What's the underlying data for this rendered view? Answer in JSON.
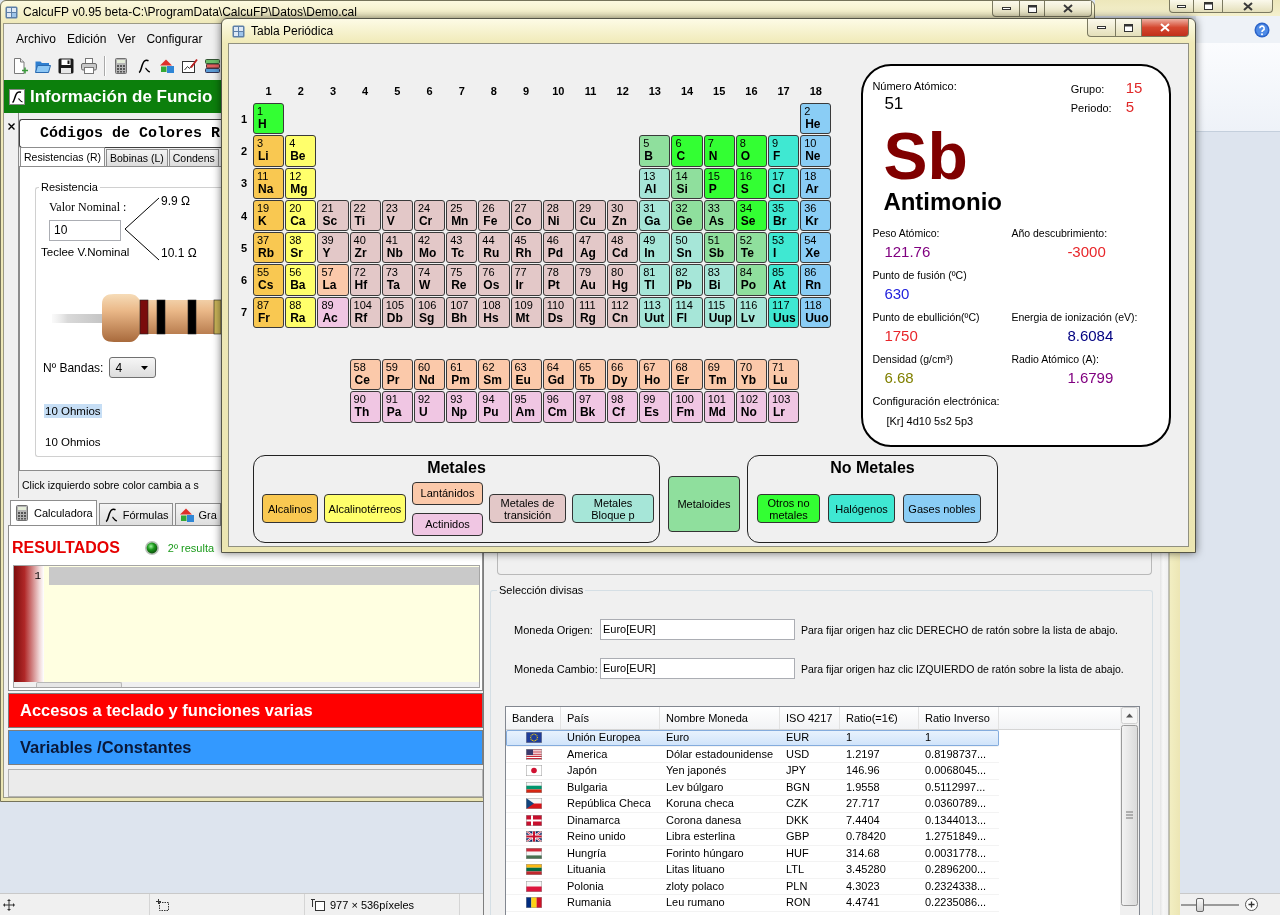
{
  "viewer": {
    "active": false,
    "status_bar": {
      "image_size": "977 × 536píxeles"
    },
    "zoom_slider": {
      "level": 0.3
    }
  },
  "main_window": {
    "active": false,
    "title": "CalcuFP v0.95 beta-C:\\ProgramData\\CalcuFP\\Datos\\Demo.cal",
    "menu": [
      "Archivo",
      "Edición",
      "Ver",
      "Configurar"
    ],
    "banner": "Información de Funcio",
    "color_codes": {
      "title": "Códigos de Colores R",
      "tabs": [
        {
          "label": "Resistencias (R)",
          "selected": true
        },
        {
          "label": "Bobinas (L)",
          "selected": false
        },
        {
          "label": "Condens",
          "selected": false
        }
      ],
      "group": "Resistencia",
      "nominal_label": "Valor Nominal :",
      "nominal_value": "10",
      "hint": "Teclee V.Nominal",
      "min_value": "9.9 Ω",
      "max_value": "10.1 Ω",
      "bands": [
        {
          "color": "#7a0c0c"
        },
        {
          "color": "#000000"
        },
        {
          "color": "#000000"
        },
        {
          "color": "#c9b458"
        }
      ],
      "bands_label": "Nº Bandas:",
      "bands_count": "4",
      "readings": [
        {
          "text": "10 Ohmios",
          "selected": true
        },
        {
          "text": "10 Ohmios",
          "selected": false
        }
      ],
      "status": "Click izquierdo sobre color cambia a s"
    },
    "calc_tabs": [
      {
        "label": "Calculadora",
        "selected": true
      },
      {
        "label": "Fórmulas",
        "selected": false
      },
      {
        "label": "Gra",
        "selected": false
      }
    ],
    "results": {
      "title": "RESULTADOS",
      "note": "2º resulta",
      "line_numbers": [
        "1"
      ]
    },
    "panels": [
      {
        "label": "Accesos a teclado y funciones varias",
        "color": "#ff0000"
      },
      {
        "label": "Variables /Constantes",
        "color": "#3399ff"
      }
    ]
  },
  "periodic_window": {
    "active": true,
    "title": "Tabla Periódica",
    "groups": [
      "1",
      "2",
      "3",
      "4",
      "5",
      "6",
      "7",
      "8",
      "9",
      "10",
      "11",
      "12",
      "13",
      "14",
      "15",
      "16",
      "17",
      "18"
    ],
    "periods": [
      {
        "label": "1",
        "s_block": [
          {
            "number": "1",
            "symbol": "H",
            "kind": "nonmetal"
          }
        ],
        "p_block": [
          {
            "number": "2",
            "symbol": "He",
            "kind": "noble_gas"
          }
        ]
      },
      {
        "label": "2",
        "s_block": [
          {
            "number": "3",
            "symbol": "Li",
            "kind": "alkali"
          },
          {
            "number": "4",
            "symbol": "Be",
            "kind": "alkaline_earth"
          }
        ],
        "p_block": [
          {
            "number": "5",
            "symbol": "B",
            "kind": "metalloid"
          },
          {
            "number": "6",
            "symbol": "C",
            "kind": "nonmetal"
          },
          {
            "number": "7",
            "symbol": "N",
            "kind": "nonmetal"
          },
          {
            "number": "8",
            "symbol": "O",
            "kind": "nonmetal"
          },
          {
            "number": "9",
            "symbol": "F",
            "kind": "halogen"
          },
          {
            "number": "10",
            "symbol": "Ne",
            "kind": "noble_gas"
          }
        ]
      },
      {
        "label": "3",
        "s_block": [
          {
            "number": "11",
            "symbol": "Na",
            "kind": "alkali"
          },
          {
            "number": "12",
            "symbol": "Mg",
            "kind": "alkaline_earth"
          }
        ],
        "p_block": [
          {
            "number": "13",
            "symbol": "Al",
            "kind": "p_metal"
          },
          {
            "number": "14",
            "symbol": "Si",
            "kind": "metalloid"
          },
          {
            "number": "15",
            "symbol": "P",
            "kind": "nonmetal"
          },
          {
            "number": "16",
            "symbol": "S",
            "kind": "nonmetal"
          },
          {
            "number": "17",
            "symbol": "Cl",
            "kind": "halogen"
          },
          {
            "number": "18",
            "symbol": "Ar",
            "kind": "noble_gas"
          }
        ]
      },
      {
        "label": "4",
        "s_block": [
          {
            "number": "19",
            "symbol": "K",
            "kind": "alkali"
          },
          {
            "number": "20",
            "symbol": "Ca",
            "kind": "alkaline_earth"
          }
        ],
        "d_block": [
          {
            "number": "21",
            "symbol": "Sc",
            "kind": "transition"
          },
          {
            "number": "22",
            "symbol": "Ti",
            "kind": "transition"
          },
          {
            "number": "23",
            "symbol": "V",
            "kind": "transition"
          },
          {
            "number": "24",
            "symbol": "Cr",
            "kind": "transition"
          },
          {
            "number": "25",
            "symbol": "Mn",
            "kind": "transition"
          },
          {
            "number": "26",
            "symbol": "Fe",
            "kind": "transition"
          },
          {
            "number": "27",
            "symbol": "Co",
            "kind": "transition"
          },
          {
            "number": "28",
            "symbol": "Ni",
            "kind": "transition"
          },
          {
            "number": "29",
            "symbol": "Cu",
            "kind": "transition"
          },
          {
            "number": "30",
            "symbol": "Zn",
            "kind": "transition"
          }
        ],
        "p_block": [
          {
            "number": "31",
            "symbol": "Ga",
            "kind": "p_metal"
          },
          {
            "number": "32",
            "symbol": "Ge",
            "kind": "metalloid"
          },
          {
            "number": "33",
            "symbol": "As",
            "kind": "metalloid"
          },
          {
            "number": "34",
            "symbol": "Se",
            "kind": "nonmetal"
          },
          {
            "number": "35",
            "symbol": "Br",
            "kind": "halogen"
          },
          {
            "number": "36",
            "symbol": "Kr",
            "kind": "noble_gas"
          }
        ]
      },
      {
        "label": "5",
        "s_block": [
          {
            "number": "37",
            "symbol": "Rb",
            "kind": "alkali"
          },
          {
            "number": "38",
            "symbol": "Sr",
            "kind": "alkaline_earth"
          }
        ],
        "d_block": [
          {
            "number": "39",
            "symbol": "Y",
            "kind": "transition"
          },
          {
            "number": "40",
            "symbol": "Zr",
            "kind": "transition"
          },
          {
            "number": "41",
            "symbol": "Nb",
            "kind": "transition"
          },
          {
            "number": "42",
            "symbol": "Mo",
            "kind": "transition"
          },
          {
            "number": "43",
            "symbol": "Tc",
            "kind": "transition"
          },
          {
            "number": "44",
            "symbol": "Ru",
            "kind": "transition"
          },
          {
            "number": "45",
            "symbol": "Rh",
            "kind": "transition"
          },
          {
            "number": "46",
            "symbol": "Pd",
            "kind": "transition"
          },
          {
            "number": "47",
            "symbol": "Ag",
            "kind": "transition"
          },
          {
            "number": "48",
            "symbol": "Cd",
            "kind": "transition"
          }
        ],
        "p_block": [
          {
            "number": "49",
            "symbol": "In",
            "kind": "p_metal"
          },
          {
            "number": "50",
            "symbol": "Sn",
            "kind": "p_metal"
          },
          {
            "number": "51",
            "symbol": "Sb",
            "kind": "metalloid"
          },
          {
            "number": "52",
            "symbol": "Te",
            "kind": "metalloid"
          },
          {
            "number": "53",
            "symbol": "I",
            "kind": "halogen"
          },
          {
            "number": "54",
            "symbol": "Xe",
            "kind": "noble_gas"
          }
        ]
      },
      {
        "label": "6",
        "s_block": [
          {
            "number": "55",
            "symbol": "Cs",
            "kind": "alkali"
          },
          {
            "number": "56",
            "symbol": "Ba",
            "kind": "alkaline_earth"
          }
        ],
        "d_block": [
          {
            "number": "57",
            "symbol": "La",
            "kind": "lanthanide"
          },
          {
            "number": "72",
            "symbol": "Hf",
            "kind": "transition"
          },
          {
            "number": "73",
            "symbol": "Ta",
            "kind": "transition"
          },
          {
            "number": "74",
            "symbol": "W",
            "kind": "transition"
          },
          {
            "number": "75",
            "symbol": "Re",
            "kind": "transition"
          },
          {
            "number": "76",
            "symbol": "Os",
            "kind": "transition"
          },
          {
            "number": "77",
            "symbol": "Ir",
            "kind": "transition"
          },
          {
            "number": "78",
            "symbol": "Pt",
            "kind": "transition"
          },
          {
            "number": "79",
            "symbol": "Au",
            "kind": "transition"
          },
          {
            "number": "80",
            "symbol": "Hg",
            "kind": "transition"
          }
        ],
        "p_block": [
          {
            "number": "81",
            "symbol": "Tl",
            "kind": "p_metal"
          },
          {
            "number": "82",
            "symbol": "Pb",
            "kind": "p_metal"
          },
          {
            "number": "83",
            "symbol": "Bi",
            "kind": "p_metal"
          },
          {
            "number": "84",
            "symbol": "Po",
            "kind": "metalloid"
          },
          {
            "number": "85",
            "symbol": "At",
            "kind": "halogen"
          },
          {
            "number": "86",
            "symbol": "Rn",
            "kind": "noble_gas"
          }
        ]
      },
      {
        "label": "7",
        "s_block": [
          {
            "number": "87",
            "symbol": "Fr",
            "kind": "alkali"
          },
          {
            "number": "88",
            "symbol": "Ra",
            "kind": "alkaline_earth"
          }
        ],
        "d_block": [
          {
            "number": "89",
            "symbol": "Ac",
            "kind": "actinide"
          },
          {
            "number": "104",
            "symbol": "Rf",
            "kind": "transition"
          },
          {
            "number": "105",
            "symbol": "Db",
            "kind": "transition"
          },
          {
            "number": "106",
            "symbol": "Sg",
            "kind": "transition"
          },
          {
            "number": "107",
            "symbol": "Bh",
            "kind": "transition"
          },
          {
            "number": "108",
            "symbol": "Hs",
            "kind": "transition"
          },
          {
            "number": "109",
            "symbol": "Mt",
            "kind": "transition"
          },
          {
            "number": "110",
            "symbol": "Ds",
            "kind": "transition"
          },
          {
            "number": "111",
            "symbol": "Rg",
            "kind": "transition"
          },
          {
            "number": "112",
            "symbol": "Cn",
            "kind": "transition"
          }
        ],
        "p_block": [
          {
            "number": "113",
            "symbol": "Uut",
            "kind": "p_metal"
          },
          {
            "number": "114",
            "symbol": "Fl",
            "kind": "p_metal"
          },
          {
            "number": "115",
            "symbol": "Uup",
            "kind": "p_metal"
          },
          {
            "number": "116",
            "symbol": "Lv",
            "kind": "p_metal"
          },
          {
            "number": "117",
            "symbol": "Uus",
            "kind": "halogen"
          },
          {
            "number": "118",
            "symbol": "Uuo",
            "kind": "noble_gas"
          }
        ]
      }
    ],
    "f_block": [
      {
        "elements": [
          {
            "number": "58",
            "symbol": "Ce",
            "kind": "lanthanide"
          },
          {
            "number": "59",
            "symbol": "Pr",
            "kind": "lanthanide"
          },
          {
            "number": "60",
            "symbol": "Nd",
            "kind": "lanthanide"
          },
          {
            "number": "61",
            "symbol": "Pm",
            "kind": "lanthanide"
          },
          {
            "number": "62",
            "symbol": "Sm",
            "kind": "lanthanide"
          },
          {
            "number": "63",
            "symbol": "Eu",
            "kind": "lanthanide"
          },
          {
            "number": "64",
            "symbol": "Gd",
            "kind": "lanthanide"
          },
          {
            "number": "65",
            "symbol": "Tb",
            "kind": "lanthanide"
          },
          {
            "number": "66",
            "symbol": "Dy",
            "kind": "lanthanide"
          },
          {
            "number": "67",
            "symbol": "Ho",
            "kind": "lanthanide"
          },
          {
            "number": "68",
            "symbol": "Er",
            "kind": "lanthanide"
          },
          {
            "number": "69",
            "symbol": "Tm",
            "kind": "lanthanide"
          },
          {
            "number": "70",
            "symbol": "Yb",
            "kind": "lanthanide"
          },
          {
            "number": "71",
            "symbol": "Lu",
            "kind": "lanthanide"
          }
        ]
      },
      {
        "elements": [
          {
            "number": "90",
            "symbol": "Th",
            "kind": "actinide"
          },
          {
            "number": "91",
            "symbol": "Pa",
            "kind": "actinide"
          },
          {
            "number": "92",
            "symbol": "U",
            "kind": "actinide"
          },
          {
            "number": "93",
            "symbol": "Np",
            "kind": "actinide"
          },
          {
            "number": "94",
            "symbol": "Pu",
            "kind": "actinide"
          },
          {
            "number": "95",
            "symbol": "Am",
            "kind": "actinide"
          },
          {
            "number": "96",
            "symbol": "Cm",
            "kind": "actinide"
          },
          {
            "number": "97",
            "symbol": "Bk",
            "kind": "actinide"
          },
          {
            "number": "98",
            "symbol": "Cf",
            "kind": "actinide"
          },
          {
            "number": "99",
            "symbol": "Es",
            "kind": "actinide"
          },
          {
            "number": "100",
            "symbol": "Fm",
            "kind": "actinide"
          },
          {
            "number": "101",
            "symbol": "Md",
            "kind": "actinide"
          },
          {
            "number": "102",
            "symbol": "No",
            "kind": "actinide"
          },
          {
            "number": "103",
            "symbol": "Lr",
            "kind": "actinide"
          }
        ]
      }
    ],
    "element_info": {
      "number_label": "Número Atómico:",
      "number": "51",
      "group_label": "Grupo:",
      "group": "15",
      "period_label": "Periodo:",
      "period": "5",
      "symbol": "Sb",
      "name": "Antimonio",
      "property_rows": [
        {
          "left": {
            "label": "Peso Atómico:",
            "value": "121.76",
            "color": "#800080"
          },
          "right": {
            "label": "Año descubrimiento:",
            "value": "-3000",
            "color": "#e8262a"
          }
        },
        {
          "left": {
            "label": "Punto de fusión (ºC)",
            "value": "630",
            "color": "#2222dd"
          }
        },
        {
          "left": {
            "label": "Punto de ebullición(ºC)",
            "value": "1750",
            "color": "#e8262a"
          },
          "right": {
            "label": "Energia de ionización (eV):",
            "value": "8.6084",
            "color": "#000080"
          }
        },
        {
          "left": {
            "label": "Densidad (g/cm³)",
            "value": "6.68",
            "color": "#808000"
          },
          "right": {
            "label": "Radio Atómico (A):",
            "value": "1.6799",
            "color": "#800080"
          }
        }
      ],
      "configuration_label": "Configuración electrónica:",
      "configuration": "[Kr] 4d10 5s2 5p3"
    },
    "legend": {
      "metals": {
        "title": "Metales",
        "columns": [
          {
            "items": [
              {
                "label": "Alcalinos",
                "kind": "alkali",
                "color": "#f9c851"
              }
            ]
          },
          {
            "items": [
              {
                "label": "Alcalinotérreos",
                "kind": "alkaline_earth",
                "color": "#ffff6b"
              }
            ]
          },
          {
            "items": [
              {
                "label": "Lantánidos",
                "kind": "lanthanide",
                "color": "#fbc9aa"
              },
              {
                "label": "Actinidos",
                "kind": "actinide",
                "color": "#f0c6e3"
              }
            ]
          },
          {
            "items": [
              {
                "label": "Metales de transición",
                "kind": "transition",
                "color": "#e3c8c8"
              }
            ]
          },
          {
            "items": [
              {
                "label": "Metales Bloque p",
                "kind": "p_metal",
                "color": "#a6e6d8"
              }
            ]
          }
        ]
      },
      "metalloids": {
        "label": "Metaloides",
        "kind": "metalloid",
        "color": "#8fdf9d"
      },
      "nonmetals": {
        "title": "No Metales",
        "columns": [
          {
            "items": [
              {
                "label": "Otros no metales",
                "kind": "nonmetal",
                "color": "#33ff33"
              }
            ]
          },
          {
            "items": [
              {
                "label": "Halógenos",
                "kind": "halogen",
                "color": "#3fe8d2"
              }
            ]
          },
          {
            "items": [
              {
                "label": "Gases nobles",
                "kind": "noble_gas",
                "color": "#8acdf5"
              }
            ]
          }
        ]
      }
    }
  },
  "currency_window": {
    "group": "Selección divisas",
    "fields": [
      {
        "label": "Moneda Origen:",
        "value": "Euro[EUR]",
        "hint": "Para fijar origen haz clic DERECHO de ratón sobre la lista de abajo."
      },
      {
        "label": "Moneda Cambio:",
        "value": "Euro[EUR]",
        "hint": "Para fijar origen haz clic IZQUIERDO de ratón sobre la lista de abajo."
      }
    ],
    "table": {
      "columns": [
        "Bandera",
        "País",
        "Nombre Moneda",
        "ISO 4217",
        "Ratio(=1€)",
        "Ratio Inverso"
      ],
      "rows": [
        {
          "selected": true,
          "cells": [
            "",
            "Unión Europea",
            "Euro",
            "EUR",
            "1",
            "1"
          ]
        },
        {
          "selected": false,
          "cells": [
            "",
            "America",
            "Dólar estadounidense",
            "USD",
            "1.2197",
            "0.8198737..."
          ]
        },
        {
          "selected": false,
          "cells": [
            "",
            "Japón",
            "Yen japonés",
            "JPY",
            "146.96",
            "0.0068045..."
          ]
        },
        {
          "selected": false,
          "cells": [
            "",
            "Bulgaria",
            "Lev búlgaro",
            "BGN",
            "1.9558",
            "0.5112997..."
          ]
        },
        {
          "selected": false,
          "cells": [
            "",
            "República Checa",
            "Koruna checa",
            "CZK",
            "27.717",
            "0.0360789..."
          ]
        },
        {
          "selected": false,
          "cells": [
            "",
            "Dinamarca",
            "Corona danesa",
            "DKK",
            "7.4404",
            "0.1344013..."
          ]
        },
        {
          "selected": false,
          "cells": [
            "",
            "Reino unido",
            "Libra esterlina",
            "GBP",
            "0.78420",
            "1.2751849..."
          ]
        },
        {
          "selected": false,
          "cells": [
            "",
            "Hungría",
            "Forinto húngaro",
            "HUF",
            "314.68",
            "0.0031778..."
          ]
        },
        {
          "selected": false,
          "cells": [
            "",
            "Lituania",
            "Litas lituano",
            "LTL",
            "3.45280",
            "0.2896200..."
          ]
        },
        {
          "selected": false,
          "cells": [
            "",
            "Polonia",
            "zloty polaco",
            "PLN",
            "4.3023",
            "0.2324338..."
          ]
        },
        {
          "selected": false,
          "cells": [
            "",
            "Rumania",
            "Leu rumano",
            "RON",
            "4.4741",
            "0.2235086..."
          ]
        }
      ]
    }
  }
}
